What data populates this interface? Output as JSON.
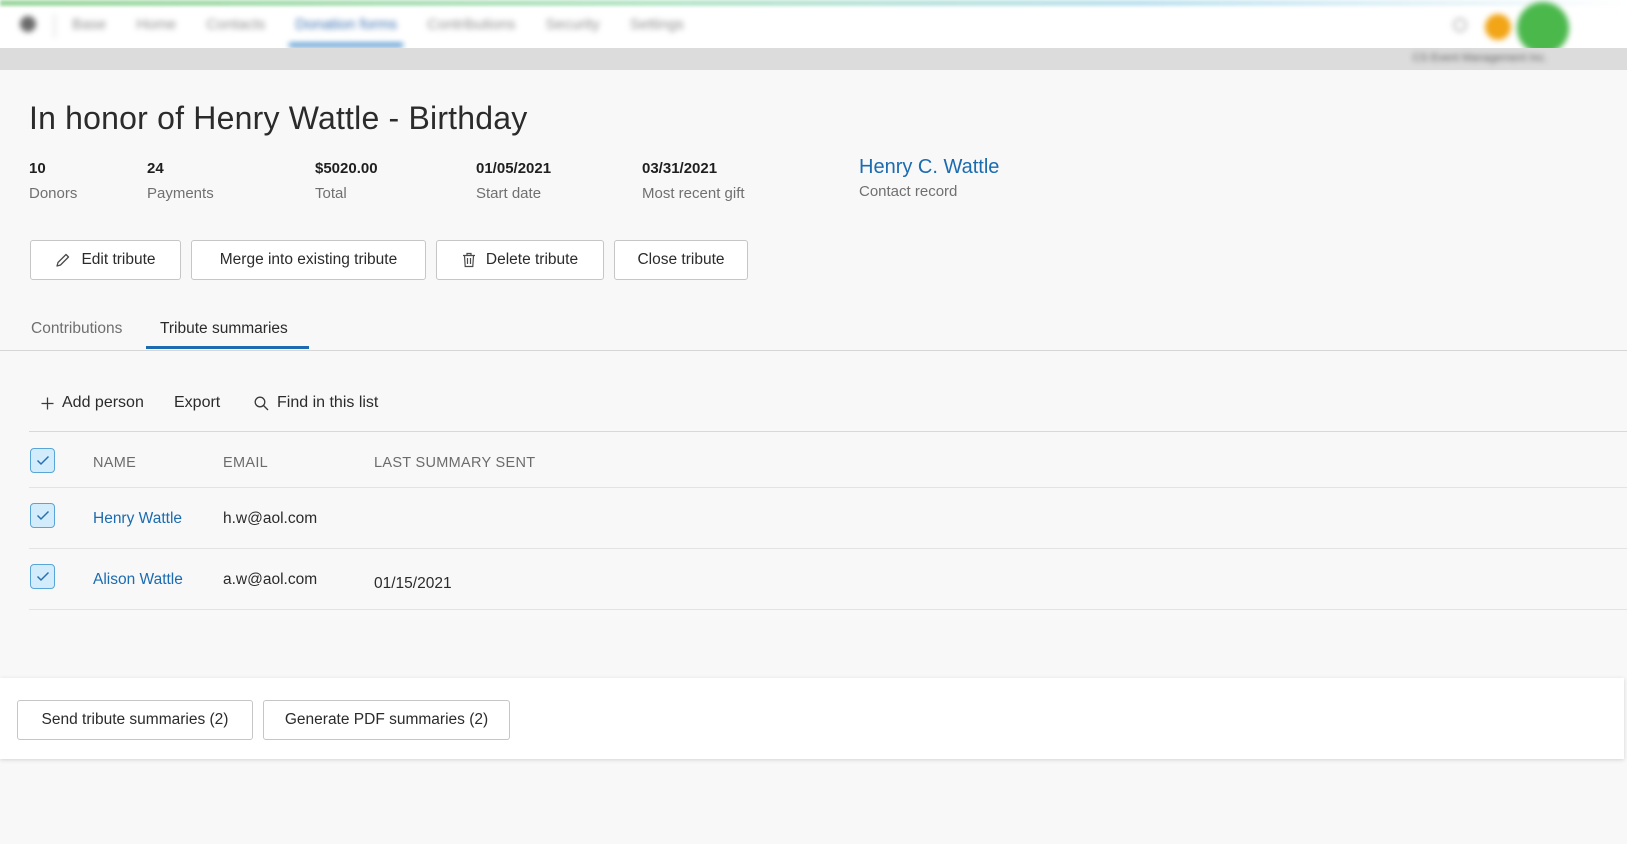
{
  "nav": {
    "items": [
      "Base",
      "Home",
      "Contacts",
      "Donation forms",
      "Contributions",
      "Security",
      "Settings"
    ],
    "active_index": 3,
    "org_name": "CS Event Management Inc."
  },
  "page": {
    "title": "In honor of Henry Wattle - Birthday"
  },
  "stats": [
    {
      "value": "10",
      "label": "Donors"
    },
    {
      "value": "24",
      "label": "Payments"
    },
    {
      "value": "$5020.00",
      "label": "Total"
    },
    {
      "value": "01/05/2021",
      "label": "Start date"
    },
    {
      "value": "03/31/2021",
      "label": "Most recent gift"
    }
  ],
  "contact": {
    "name": "Henry C. Wattle",
    "label": "Contact record"
  },
  "actions": {
    "edit": "Edit tribute",
    "merge": "Merge into existing tribute",
    "delete": "Delete tribute",
    "close": "Close tribute"
  },
  "tabs": [
    {
      "label": "Contributions",
      "active": false
    },
    {
      "label": "Tribute summaries",
      "active": true
    }
  ],
  "toolbar": {
    "add_person": "Add person",
    "export": "Export",
    "find": "Find in this list"
  },
  "table": {
    "columns": [
      "NAME",
      "EMAIL",
      "LAST SUMMARY SENT"
    ],
    "rows": [
      {
        "name": "Henry Wattle",
        "email": "h.w@aol.com",
        "last_sent": "",
        "checked": true
      },
      {
        "name": "Alison Wattle",
        "email": "a.w@aol.com",
        "last_sent": "01/15/2021",
        "checked": true
      }
    ],
    "header_checked": true
  },
  "bottom_actions": {
    "send": "Send tribute summaries (2)",
    "generate": "Generate PDF summaries (2)"
  },
  "colors": {
    "accent": "#1b6bb0",
    "checkbox_fill": "#d3ecfb",
    "checkbox_border": "#5aa5d8",
    "avatar": "#4bb84c",
    "notification": "#f2a516"
  }
}
